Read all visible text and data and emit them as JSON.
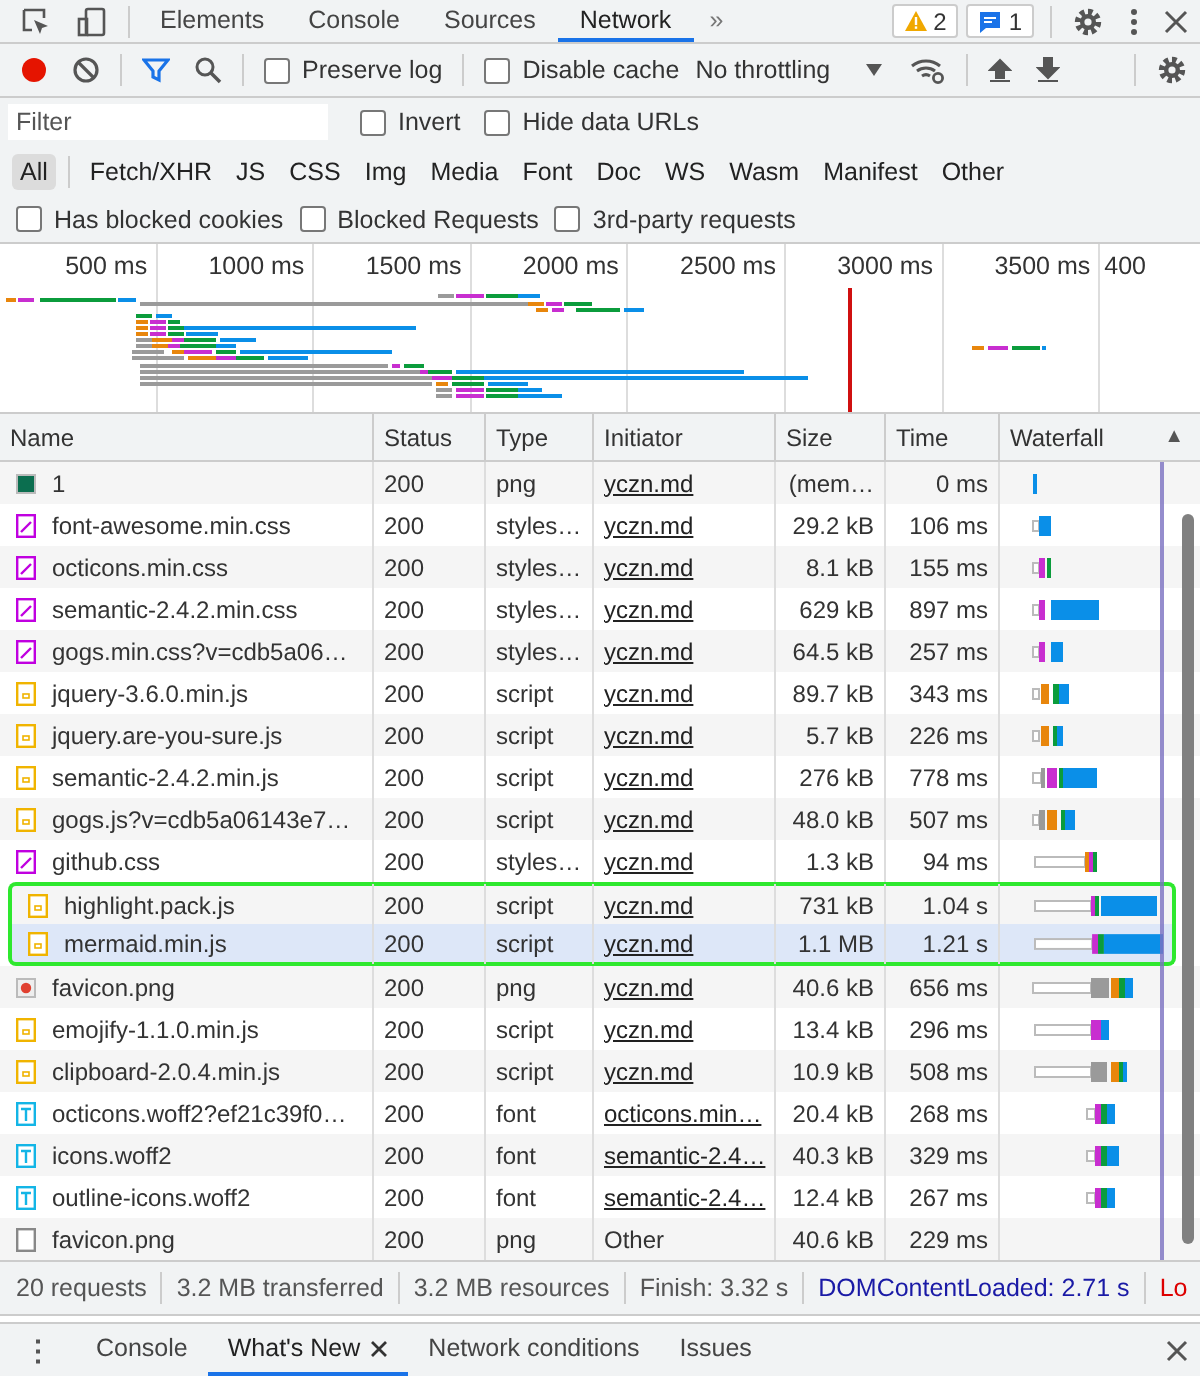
{
  "tabs": [
    {
      "label": "Elements",
      "selected": false
    },
    {
      "label": "Console",
      "selected": false
    },
    {
      "label": "Sources",
      "selected": false
    },
    {
      "label": "Network",
      "selected": true
    }
  ],
  "more_tabs": "»",
  "badges": [
    {
      "kind": "warning",
      "count": "2"
    },
    {
      "kind": "message",
      "count": "1"
    }
  ],
  "toolbar": {
    "recording": true,
    "preserve_log": {
      "label": "Preserve log",
      "checked": false
    },
    "disable_cache": {
      "label": "Disable cache",
      "checked": false
    },
    "throttling": "No throttling"
  },
  "filter": {
    "placeholder": "Filter",
    "invert": {
      "label": "Invert",
      "checked": false
    },
    "hide_data_urls": {
      "label": "Hide data URLs",
      "checked": false
    }
  },
  "type_filters": [
    {
      "label": "All",
      "selected": true
    },
    {
      "label": "Fetch/XHR",
      "selected": false
    },
    {
      "label": "JS",
      "selected": false
    },
    {
      "label": "CSS",
      "selected": false
    },
    {
      "label": "Img",
      "selected": false
    },
    {
      "label": "Media",
      "selected": false
    },
    {
      "label": "Font",
      "selected": false
    },
    {
      "label": "Doc",
      "selected": false
    },
    {
      "label": "WS",
      "selected": false
    },
    {
      "label": "Wasm",
      "selected": false
    },
    {
      "label": "Manifest",
      "selected": false
    },
    {
      "label": "Other",
      "selected": false
    }
  ],
  "options": [
    {
      "label": "Has blocked cookies",
      "checked": false
    },
    {
      "label": "Blocked Requests",
      "checked": false
    },
    {
      "label": "3rd-party requests",
      "checked": false
    }
  ],
  "overview": {
    "ticks": [
      "500 ms",
      "1000 ms",
      "1500 ms",
      "2000 ms",
      "2500 ms",
      "3000 ms",
      "3500 ms",
      "400"
    ]
  },
  "table": {
    "columns": [
      "Name",
      "Status",
      "Type",
      "Initiator",
      "Size",
      "Time",
      "Waterfall"
    ],
    "sort_indicator": "▲",
    "rows": [
      {
        "kind": "image",
        "name": "1",
        "status": "200",
        "type": "png",
        "initiator": "yczn.md",
        "initiator_link": true,
        "size": "(mem…",
        "time": "0 ms",
        "selected": false,
        "outlined": false
      },
      {
        "kind": "css",
        "name": "font-awesome.min.css",
        "status": "200",
        "type": "styles…",
        "initiator": "yczn.md",
        "initiator_link": true,
        "size": "29.2 kB",
        "time": "106 ms",
        "selected": false,
        "outlined": false
      },
      {
        "kind": "css",
        "name": "octicons.min.css",
        "status": "200",
        "type": "styles…",
        "initiator": "yczn.md",
        "initiator_link": true,
        "size": "8.1 kB",
        "time": "155 ms",
        "selected": false,
        "outlined": false
      },
      {
        "kind": "css",
        "name": "semantic-2.4.2.min.css",
        "status": "200",
        "type": "styles…",
        "initiator": "yczn.md",
        "initiator_link": true,
        "size": "629 kB",
        "time": "897 ms",
        "selected": false,
        "outlined": false
      },
      {
        "kind": "css",
        "name": "gogs.min.css?v=cdb5a06…",
        "status": "200",
        "type": "styles…",
        "initiator": "yczn.md",
        "initiator_link": true,
        "size": "64.5 kB",
        "time": "257 ms",
        "selected": false,
        "outlined": false
      },
      {
        "kind": "script",
        "name": "jquery-3.6.0.min.js",
        "status": "200",
        "type": "script",
        "initiator": "yczn.md",
        "initiator_link": true,
        "size": "89.7 kB",
        "time": "343 ms",
        "selected": false,
        "outlined": false
      },
      {
        "kind": "script",
        "name": "jquery.are-you-sure.js",
        "status": "200",
        "type": "script",
        "initiator": "yczn.md",
        "initiator_link": true,
        "size": "5.7 kB",
        "time": "226 ms",
        "selected": false,
        "outlined": false
      },
      {
        "kind": "script",
        "name": "semantic-2.4.2.min.js",
        "status": "200",
        "type": "script",
        "initiator": "yczn.md",
        "initiator_link": true,
        "size": "276 kB",
        "time": "778 ms",
        "selected": false,
        "outlined": false
      },
      {
        "kind": "script",
        "name": "gogs.js?v=cdb5a06143e7…",
        "status": "200",
        "type": "script",
        "initiator": "yczn.md",
        "initiator_link": true,
        "size": "48.0 kB",
        "time": "507 ms",
        "selected": false,
        "outlined": false
      },
      {
        "kind": "css",
        "name": "github.css",
        "status": "200",
        "type": "styles…",
        "initiator": "yczn.md",
        "initiator_link": true,
        "size": "1.3 kB",
        "time": "94 ms",
        "selected": false,
        "outlined": false
      },
      {
        "kind": "script",
        "name": "highlight.pack.js",
        "status": "200",
        "type": "script",
        "initiator": "yczn.md",
        "initiator_link": true,
        "size": "731 kB",
        "time": "1.04 s",
        "selected": false,
        "outlined": true
      },
      {
        "kind": "script",
        "name": "mermaid.min.js",
        "status": "200",
        "type": "script",
        "initiator": "yczn.md",
        "initiator_link": true,
        "size": "1.1 MB",
        "time": "1.21 s",
        "selected": true,
        "outlined": true
      },
      {
        "kind": "favicon",
        "name": "favicon.png",
        "status": "200",
        "type": "png",
        "initiator": "yczn.md",
        "initiator_link": true,
        "size": "40.6 kB",
        "time": "656 ms",
        "selected": false,
        "outlined": false
      },
      {
        "kind": "script",
        "name": "emojify-1.1.0.min.js",
        "status": "200",
        "type": "script",
        "initiator": "yczn.md",
        "initiator_link": true,
        "size": "13.4 kB",
        "time": "296 ms",
        "selected": false,
        "outlined": false
      },
      {
        "kind": "script",
        "name": "clipboard-2.0.4.min.js",
        "status": "200",
        "type": "script",
        "initiator": "yczn.md",
        "initiator_link": true,
        "size": "10.9 kB",
        "time": "508 ms",
        "selected": false,
        "outlined": false
      },
      {
        "kind": "font",
        "name": "octicons.woff2?ef21c39f0…",
        "status": "200",
        "type": "font",
        "initiator": "octicons.min…",
        "initiator_link": true,
        "size": "20.4 kB",
        "time": "268 ms",
        "selected": false,
        "outlined": false
      },
      {
        "kind": "font",
        "name": "icons.woff2",
        "status": "200",
        "type": "font",
        "initiator": "semantic-2.4…",
        "initiator_link": true,
        "size": "40.3 kB",
        "time": "329 ms",
        "selected": false,
        "outlined": false
      },
      {
        "kind": "font",
        "name": "outline-icons.woff2",
        "status": "200",
        "type": "font",
        "initiator": "semantic-2.4…",
        "initiator_link": true,
        "size": "12.4 kB",
        "time": "267 ms",
        "selected": false,
        "outlined": false
      },
      {
        "kind": "document",
        "name": "favicon.png",
        "status": "200",
        "type": "png",
        "initiator": "Other",
        "initiator_link": false,
        "size": "40.6 kB",
        "time": "229 ms",
        "selected": false,
        "outlined": false
      }
    ]
  },
  "status_bar": [
    {
      "kind": "plain",
      "text": "20 requests"
    },
    {
      "kind": "plain",
      "text": "3.2 MB transferred"
    },
    {
      "kind": "plain",
      "text": "3.2 MB resources"
    },
    {
      "kind": "plain",
      "text": "Finish: 3.32 s"
    },
    {
      "kind": "domcontentloaded",
      "text": "DOMContentLoaded: 2.71 s"
    },
    {
      "kind": "load",
      "text": "Lo"
    }
  ],
  "drawer": {
    "more": "⋮",
    "tabs": [
      {
        "label": "Console",
        "selected": false,
        "closable": false
      },
      {
        "label": "What's New",
        "selected": true,
        "closable": true
      },
      {
        "label": "Network conditions",
        "selected": false,
        "closable": false
      },
      {
        "label": "Issues",
        "selected": false,
        "closable": false
      }
    ]
  }
}
